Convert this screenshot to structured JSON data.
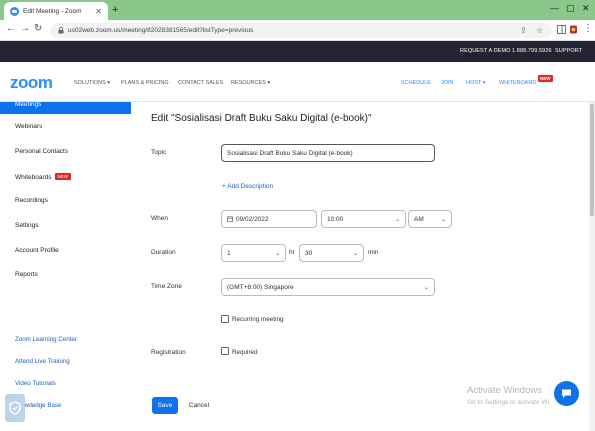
{
  "browser": {
    "tab_title": "Edit Meeting - Zoom",
    "new_tab_icon": "+",
    "url": "us02web.zoom.us/meeting/82028381565/edit?listType=previous"
  },
  "topbar": {
    "request_demo": "REQUEST A DEMO",
    "phone": "1.888.799.5926",
    "support": "SUPPORT"
  },
  "nav": {
    "logo": "zoom",
    "solutions": "SOLUTIONS ▾",
    "plans": "PLANS & PRICING",
    "contact": "CONTACT SALES",
    "resources": "RESOURCES ▾",
    "schedule": "SCHEDULE",
    "join": "JOIN",
    "host": "HOST ▾",
    "whiteboard": "WHITEBOARD",
    "whiteboard_badge": "NEW"
  },
  "sidebar": {
    "active": "Meetings",
    "items": [
      {
        "label": "Webinars"
      },
      {
        "label": "Personal Contacts"
      },
      {
        "label": "Whiteboards",
        "badge": "NEW"
      },
      {
        "label": "Recordings"
      },
      {
        "label": "Settings"
      },
      {
        "label": "Account Profile"
      },
      {
        "label": "Reports"
      }
    ],
    "footer": [
      {
        "label": "Zoom Learning Center"
      },
      {
        "label": "Attend Live Training"
      },
      {
        "label": "Video Tutorials"
      },
      {
        "label": "Knowledge Base"
      }
    ]
  },
  "form": {
    "title": "Edit \"Sosialisasi Draft Buku Saku Digital (e-book)\"",
    "topic_label": "Topic",
    "topic_value": "Sosialisasi Draft Buku Saku Digital (e-book)",
    "add_description": "+ Add Description",
    "when_label": "When",
    "date_value": "09/02/2022",
    "time_value": "10:00",
    "ampm_value": "AM",
    "duration_label": "Duration",
    "duration_hours": "1",
    "hr_label": "hr",
    "duration_minutes": "30",
    "min_label": "min",
    "timezone_label": "Time Zone",
    "timezone_value": "(GMT+8:00) Singapore",
    "recurring_label": "Recurring meeting",
    "registration_label": "Registration",
    "required_label": "Required",
    "save": "Save",
    "cancel": "Cancel"
  },
  "watermark": {
    "line1": "Activate Windows",
    "line2": "Go to Settings to activate Wi"
  },
  "colors": {
    "brand": "#2d8cff",
    "primary_button": "#0e72ed",
    "badge": "#e02828",
    "topbar": "#232333",
    "tabstrip": "#8bc68a"
  }
}
